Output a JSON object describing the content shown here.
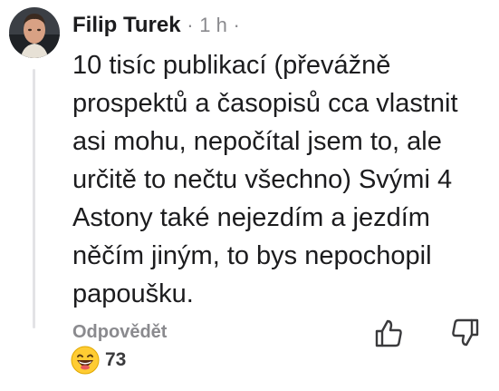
{
  "comment": {
    "author": "Filip Turek",
    "separator": "·",
    "time": "1 h",
    "text": "10 tisíc publikací (převážně prospektů a časopisů cca vlastnit asi mohu, nepočítal jsem to, ale určitě to nečtu všechno) Svými 4 Astony také nejezdím a jezdím něčím jiným, to bys nepochopil papoušku.",
    "reply_label": "Odpovědět",
    "reaction": {
      "icon": "laughing-emoji-icon",
      "count": "73"
    },
    "actions": {
      "like_icon": "thumbs-up-icon",
      "dislike_icon": "thumbs-down-icon"
    }
  },
  "colors": {
    "text": "#1c1c1e",
    "muted": "#8a8a8e",
    "emoji": "#ffcc33"
  }
}
